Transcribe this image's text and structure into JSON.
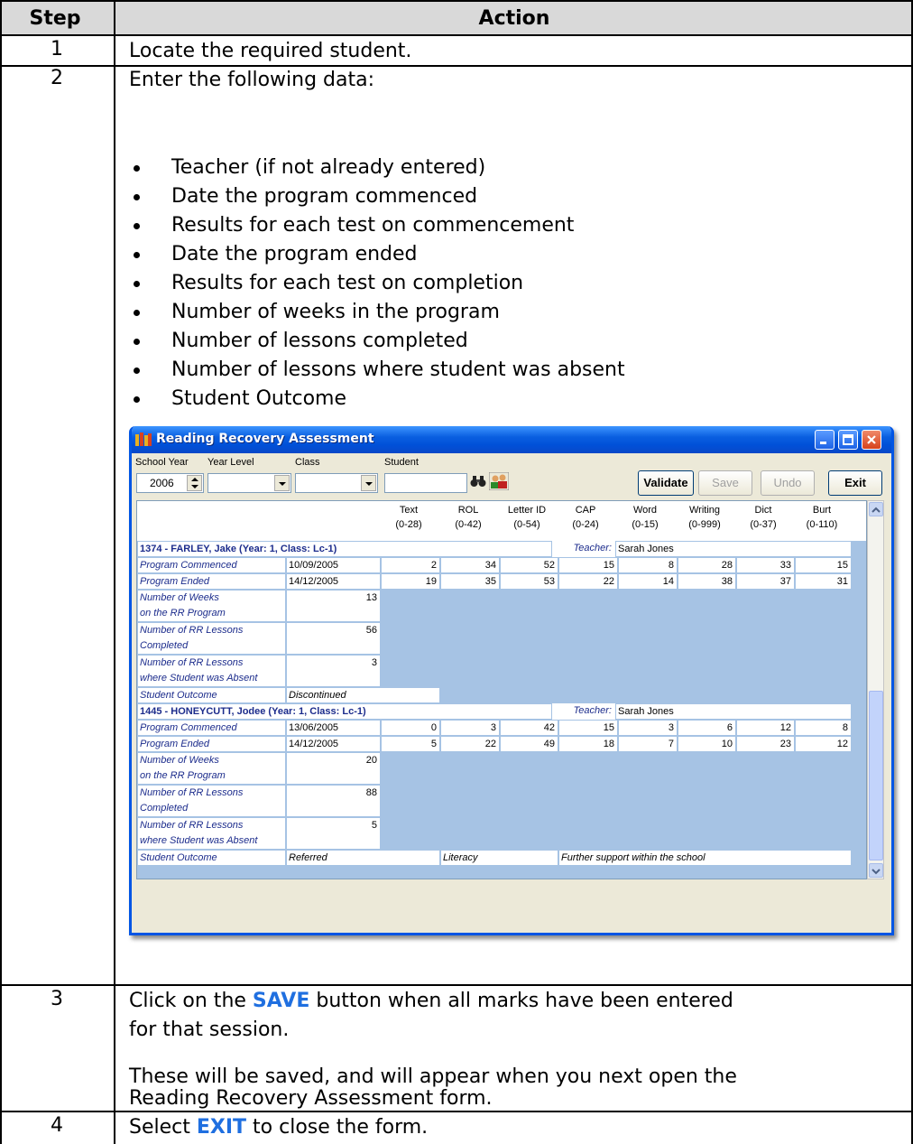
{
  "doc": {
    "header": {
      "step": "Step",
      "action": "Action"
    },
    "rows": [
      {
        "step": "1",
        "text": "Locate the required student."
      },
      {
        "step": "2",
        "intro": "Enter the following data:",
        "bullets": [
          "Teacher (if not already entered)",
          "Date the program commenced",
          "Results for each test on commencement",
          "Date the program ended",
          "Results for each test on completion",
          "Number of weeks in the program",
          "Number of lessons completed",
          "Number of lessons where student was absent",
          "Student Outcome"
        ]
      },
      {
        "step": "3",
        "line1_pre": "Click on the ",
        "line1_hl": "SAVE",
        "line1_post": " button when all marks have been entered",
        "line2": "for that session.",
        "line3": "These will be saved, and will appear when you next open the",
        "line4": "Reading Recovery Assessment form."
      },
      {
        "step": "4",
        "pre": "Select ",
        "hl": "EXIT",
        "post": " to close the form."
      }
    ],
    "highlight_color": "#1f6fe0"
  },
  "window": {
    "title": "Reading Recovery Assessment",
    "toolbar": {
      "school_year_label": "School Year",
      "school_year_value": "2006",
      "year_level_label": "Year Level",
      "class_label": "Class",
      "student_label": "Student",
      "validate": "Validate",
      "save": "Save",
      "undo": "Undo",
      "exit": "Exit"
    },
    "columns": [
      {
        "name": "Text",
        "range": "(0-28)"
      },
      {
        "name": "ROL",
        "range": "(0-42)"
      },
      {
        "name": "Letter ID",
        "range": "(0-54)"
      },
      {
        "name": "CAP",
        "range": "(0-24)"
      },
      {
        "name": "Word",
        "range": "(0-15)"
      },
      {
        "name": "Writing",
        "range": "(0-999)"
      },
      {
        "name": "Dict",
        "range": "(0-37)"
      },
      {
        "name": "Burt",
        "range": "(0-110)"
      }
    ],
    "teacher_label": "Teacher:",
    "students": [
      {
        "header": "1374 - FARLEY, Jake  (Year: 1,  Class: Lc-1)",
        "teacher": "Sarah Jones",
        "commenced_label": "Program Commenced",
        "commenced_date": "10/09/2005",
        "commenced_scores": [
          "2",
          "34",
          "52",
          "15",
          "8",
          "28",
          "33",
          "15"
        ],
        "ended_label": "Program Ended",
        "ended_date": "14/12/2005",
        "ended_scores": [
          "19",
          "35",
          "53",
          "22",
          "14",
          "38",
          "37",
          "31"
        ],
        "weeks_label_1": "Number of Weeks",
        "weeks_label_2": "on the RR Program",
        "weeks": "13",
        "lessons_label_1": "Number of RR Lessons",
        "lessons_label_2": "Completed",
        "lessons": "56",
        "absent_label_1": "Number of RR Lessons",
        "absent_label_2": "where Student was Absent",
        "absent": "3",
        "outcome_label": "Student Outcome",
        "outcome": "Discontinued",
        "outcome_2": "",
        "outcome_3": ""
      },
      {
        "header": "1445 - HONEYCUTT, Jodee  (Year: 1,  Class: Lc-1)",
        "teacher": "Sarah Jones",
        "commenced_label": "Program Commenced",
        "commenced_date": "13/06/2005",
        "commenced_scores": [
          "0",
          "3",
          "42",
          "15",
          "3",
          "6",
          "12",
          "8"
        ],
        "ended_label": "Program Ended",
        "ended_date": "14/12/2005",
        "ended_scores": [
          "5",
          "22",
          "49",
          "18",
          "7",
          "10",
          "23",
          "12"
        ],
        "weeks_label_1": "Number of Weeks",
        "weeks_label_2": "on the RR Program",
        "weeks": "20",
        "lessons_label_1": "Number of RR Lessons",
        "lessons_label_2": "Completed",
        "lessons": "88",
        "absent_label_1": "Number of RR Lessons",
        "absent_label_2": "where Student was Absent",
        "absent": "5",
        "outcome_label": "Student Outcome",
        "outcome": "Referred",
        "outcome_2": "Literacy",
        "outcome_3": "Further support within the school"
      }
    ]
  }
}
